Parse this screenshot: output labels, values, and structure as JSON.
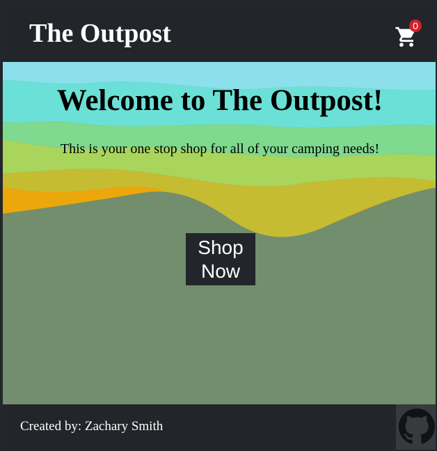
{
  "header": {
    "brand": "The Outpost",
    "cart_count": "0"
  },
  "hero": {
    "title": "Welcome to The Outpost!",
    "subtitle": "This is your one stop shop for all of your camping needs!",
    "button_line1": "Shop",
    "button_line2": "Now"
  },
  "footer": {
    "credit": "Created by: Zachary Smith"
  },
  "icons": {
    "cart": "shopping-cart-icon",
    "github": "github-icon"
  },
  "colors": {
    "dark": "#222529",
    "badge": "#d3202a",
    "sky": "#8be0ec",
    "ground": "#728e6c",
    "orange_hill": "#eca70a"
  }
}
